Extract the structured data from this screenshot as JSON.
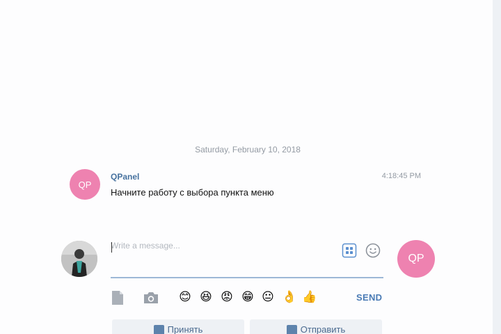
{
  "chat": {
    "date_separator": "Saturday, February 10, 2018",
    "message": {
      "avatar_initials": "QP",
      "sender": "QPanel",
      "time": "4:18:45 PM",
      "text": "Начните работу с выбора пункта меню"
    }
  },
  "composer": {
    "placeholder": "Write a message...",
    "value": "",
    "contact_avatar_initials": "QP",
    "send_label": "SEND",
    "emojis": [
      "😊",
      "😆",
      "😡",
      "😁",
      "😐",
      "👌",
      "👍"
    ]
  },
  "actions": {
    "accept_label": "Принять",
    "send_label": "Отправить"
  },
  "colors": {
    "avatar_pink": "#ee82b0",
    "accent_blue": "#4a7bb5",
    "sender_blue": "#47729f"
  }
}
